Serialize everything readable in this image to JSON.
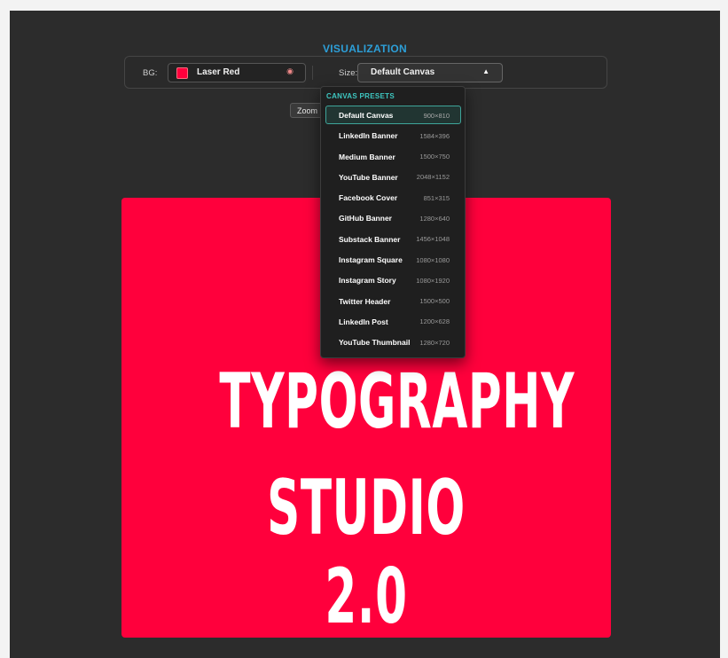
{
  "header": {
    "title": "VISUALIZATION"
  },
  "toolbar": {
    "bg_label": "BG:",
    "bg_value": "Laser Red",
    "bg_color": "#ff003c",
    "bg_icon": "palette-icon",
    "size_label": "Size:",
    "size_value": "Default Canvas",
    "size_caret": "▲"
  },
  "zoom": {
    "label": "Zoom C"
  },
  "dropdown": {
    "title": "CANVAS PRESETS",
    "selected_index": 0,
    "items": [
      {
        "name": "Default Canvas",
        "dims": "900×810"
      },
      {
        "name": "LinkedIn Banner",
        "dims": "1584×396"
      },
      {
        "name": "Medium Banner",
        "dims": "1500×750"
      },
      {
        "name": "YouTube Banner",
        "dims": "2048×1152"
      },
      {
        "name": "Facebook Cover",
        "dims": "851×315"
      },
      {
        "name": "GitHub Banner",
        "dims": "1280×640"
      },
      {
        "name": "Substack Banner",
        "dims": "1456×1048"
      },
      {
        "name": "Instagram Square",
        "dims": "1080×1080"
      },
      {
        "name": "Instagram Story",
        "dims": "1080×1920"
      },
      {
        "name": "Twitter Header",
        "dims": "1500×500"
      },
      {
        "name": "LinkedIn Post",
        "dims": "1200×628"
      },
      {
        "name": "YouTube Thumbnail",
        "dims": "1280×720"
      }
    ]
  },
  "canvas": {
    "line1": "TYPOGRAPHY",
    "line2": "STUDIO 2.0",
    "background": "#ff003c",
    "text_color": "#ffffff"
  },
  "colors": {
    "accent": "#2d9fd8",
    "preset_title": "#3ec7c1",
    "selected_border": "#3ea59a"
  }
}
